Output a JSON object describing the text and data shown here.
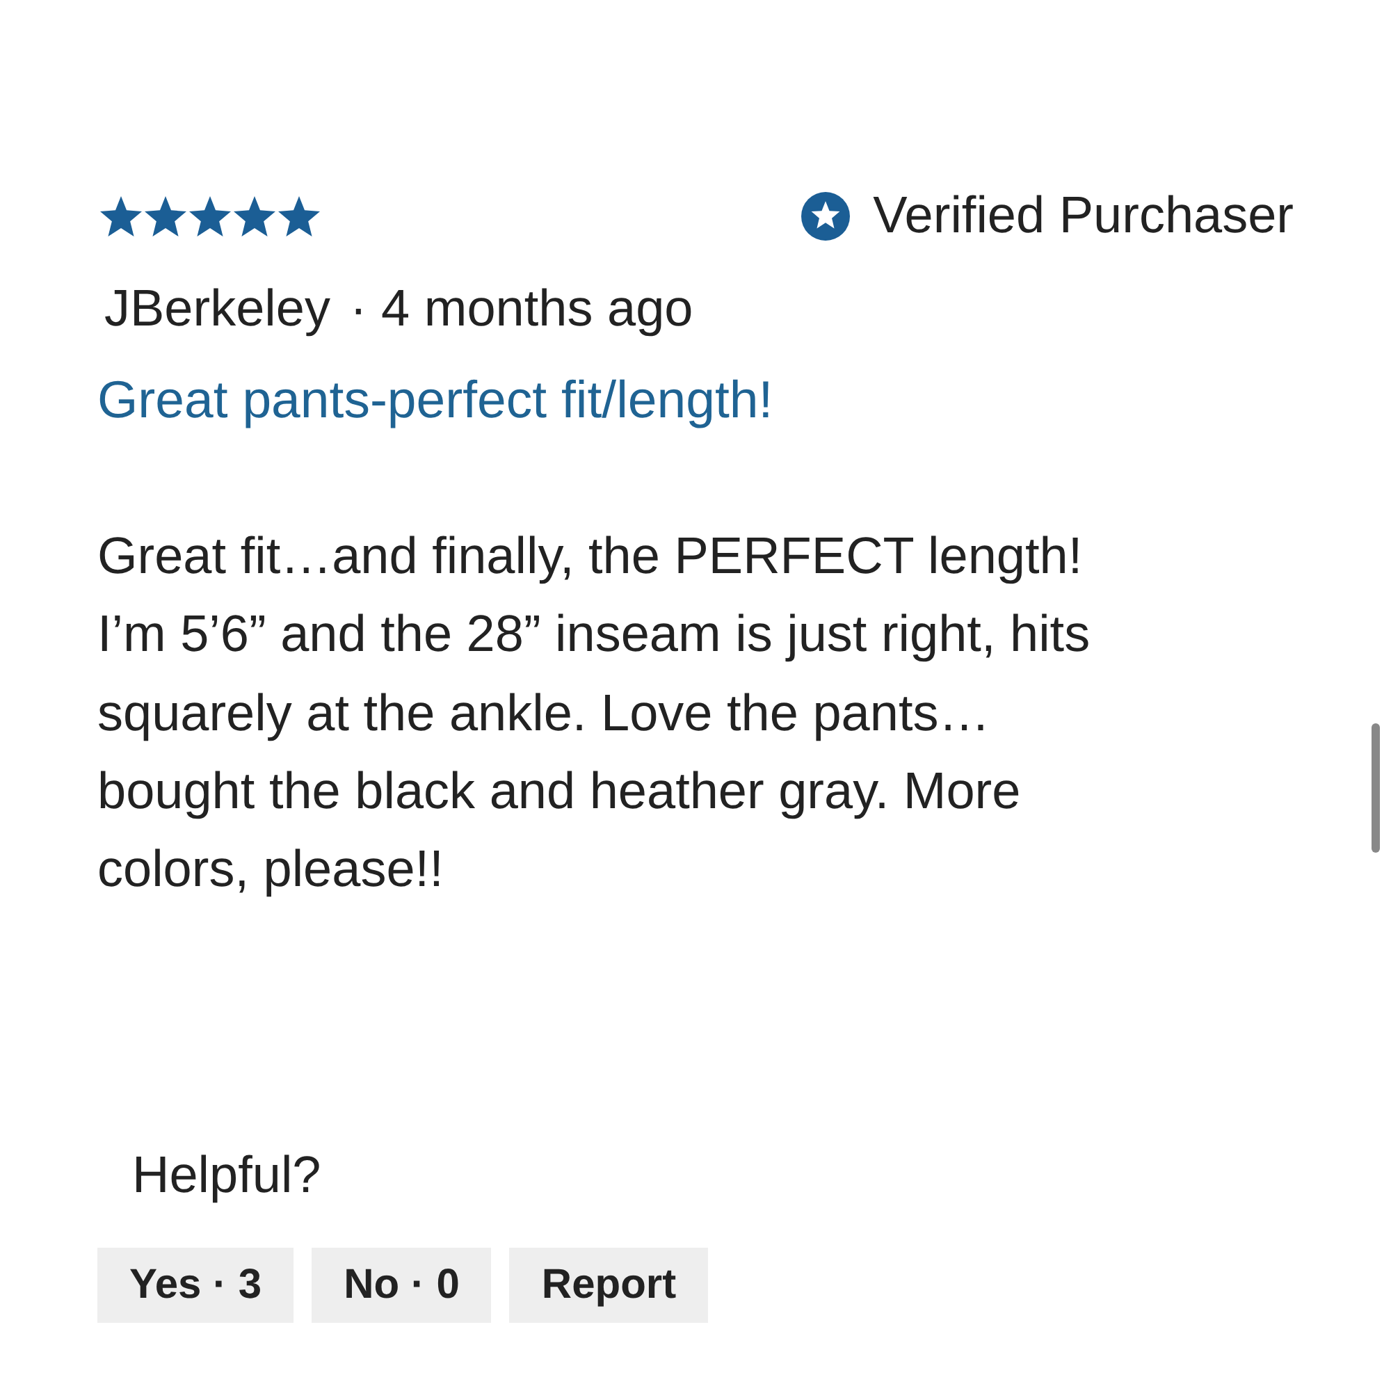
{
  "review": {
    "stars": 5,
    "verified_badge": "Verified Purchaser",
    "author": "JBerkeley",
    "age": "· 4 months ago",
    "title": "Great pants-perfect fit/length!",
    "body": "Great fit…and finally, the PERFECT length! I’m 5’6” and the 28” inseam is just right, hits squarely at the ankle. Love the pants… bought the black and heather gray. More colors, please!!"
  },
  "helpful": {
    "label": "Helpful?",
    "buttons": [
      {
        "label": "Yes · 3"
      },
      {
        "label": "No · 0"
      },
      {
        "label": "Report"
      }
    ]
  }
}
